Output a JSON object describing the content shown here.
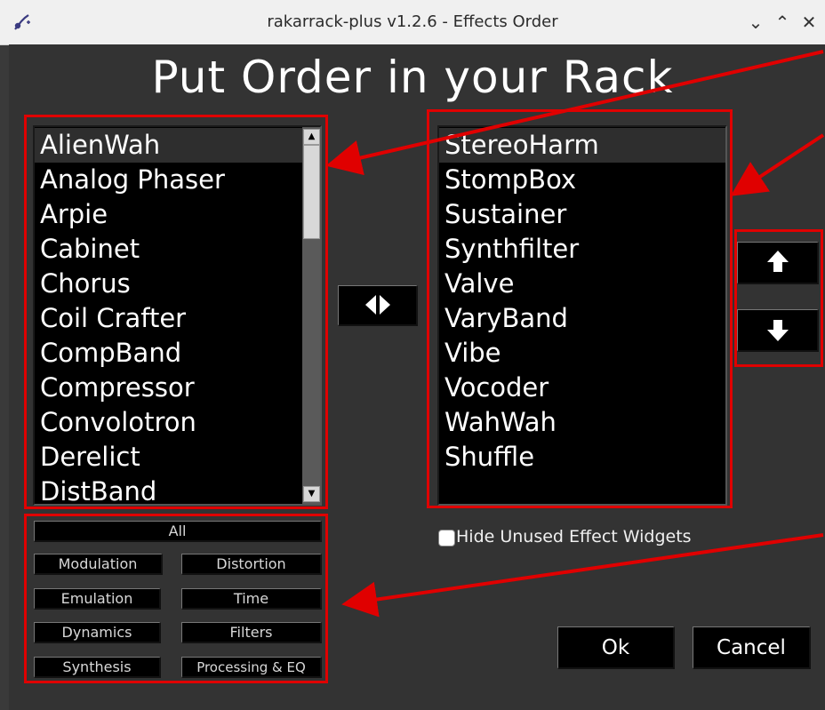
{
  "window": {
    "title": "rakarrack-plus v1.2.6 - Effects Order",
    "controls": [
      "⌄",
      "⌃",
      "✕"
    ]
  },
  "heading": "Put Order in your Rack",
  "available_effects": {
    "items": [
      "AlienWah",
      "Analog Phaser",
      "Arpie",
      "Cabinet",
      "Chorus",
      "Coil Crafter",
      "CompBand",
      "Compressor",
      "Convolotron",
      "Derelict",
      "DistBand"
    ],
    "selected": "AlienWah"
  },
  "rack_order": {
    "items": [
      "StereoHarm",
      "StompBox",
      "Sustainer",
      "Synthfilter",
      "Valve",
      "VaryBand",
      "Vibe",
      "Vocoder",
      "WahWah",
      "Shuffle"
    ],
    "selected": "StereoHarm"
  },
  "filters": {
    "all": "All",
    "modulation": "Modulation",
    "distortion": "Distortion",
    "emulation": "Emulation",
    "time": "Time",
    "dynamics": "Dynamics",
    "filters": "Filters",
    "synthesis": "Synthesis",
    "processing_eq": "Processing & EQ"
  },
  "checkbox": {
    "label": "Hide Unused Effect Widgets",
    "checked": false
  },
  "buttons": {
    "ok": "Ok",
    "cancel": "Cancel"
  },
  "icons": {
    "swap": "swap-arrows-icon",
    "up": "arrow-up-icon",
    "down": "arrow-down-icon",
    "app": "rakarrack-guitar-icon"
  },
  "colors": {
    "annotation": "#e00000",
    "panel": "#333333",
    "list_bg": "#000000"
  }
}
